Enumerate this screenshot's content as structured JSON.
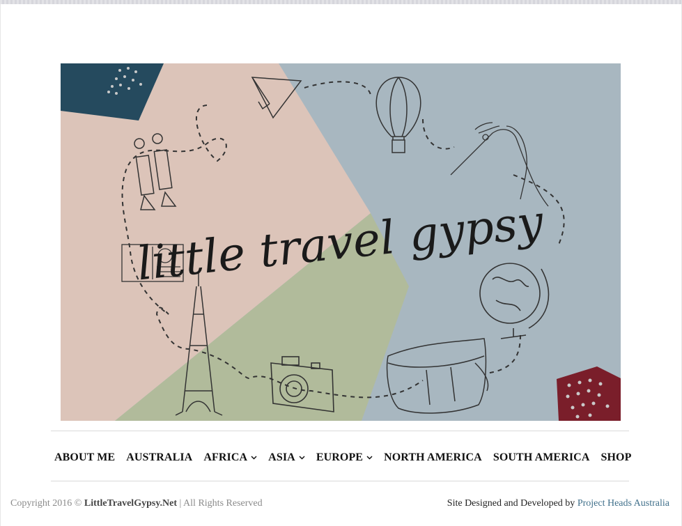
{
  "header": {
    "banner_title": "little travel gypsy",
    "colors": {
      "pink": "#dcc4b9",
      "blue": "#a8b7c0",
      "green": "#b1bb9b",
      "navy": "#254a5e",
      "maroon": "#7a1e2a"
    }
  },
  "nav": {
    "items": [
      {
        "label": "ABOUT ME",
        "dropdown": false
      },
      {
        "label": "AUSTRALIA",
        "dropdown": false
      },
      {
        "label": "AFRICA",
        "dropdown": true
      },
      {
        "label": "ASIA",
        "dropdown": true
      },
      {
        "label": "EUROPE",
        "dropdown": true
      },
      {
        "label": "NORTH AMERICA",
        "dropdown": false
      },
      {
        "label": "SOUTH AMERICA",
        "dropdown": false
      },
      {
        "label": "SHOP",
        "dropdown": false
      }
    ],
    "dropdown_icon": "chevron-down-icon"
  },
  "footer": {
    "copyright_prefix": "Copyright 2016 ©",
    "site_name": "LittleTravelGypsy.Net",
    "rights": "| All Rights Reserved",
    "credit_prefix": "Site Designed and Developed by",
    "credit_link": "Project Heads Australia"
  }
}
